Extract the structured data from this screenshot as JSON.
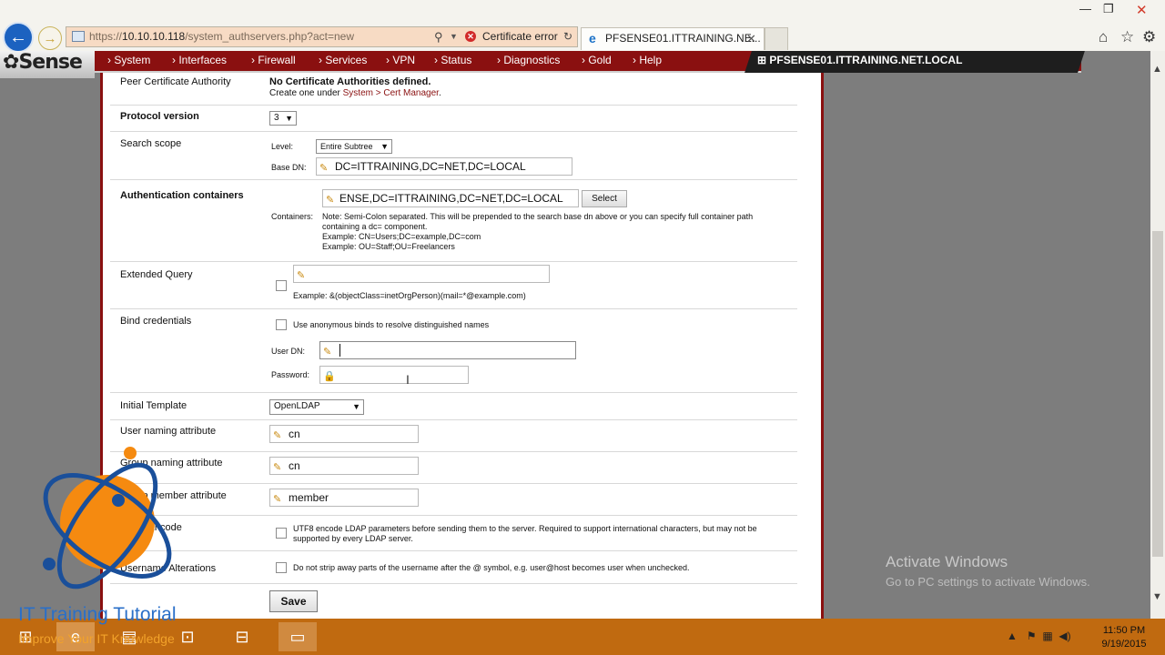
{
  "browser": {
    "url_prefix": "https://",
    "url_host": "10.10.10.118",
    "url_path": "/system_authservers.php?act=new",
    "cert_error": "Certificate error",
    "tab_title": "PFSENSE01.ITTRAINING.NE..."
  },
  "nav": {
    "logo": "Sense",
    "menu": [
      "System",
      "Interfaces",
      "Firewall",
      "Services",
      "VPN",
      "Status",
      "Diagnostics",
      "Gold",
      "Help"
    ],
    "hostname": "PFSENSE01.ITTRAINING.NET.LOCAL"
  },
  "form": {
    "peer_ca": {
      "label": "Peer Certificate Authority",
      "value": "No Certificate Authorities defined.",
      "hint_prefix": "Create one under ",
      "hint_link": "System > Cert Manager",
      "hint_suffix": "."
    },
    "protocol": {
      "label": "Protocol version",
      "value": "3"
    },
    "scope": {
      "label": "Search scope",
      "level_label": "Level:",
      "level_value": "Entire Subtree",
      "base_label": "Base DN:",
      "base_value": "DC=ITTRAINING,DC=NET,DC=LOCAL"
    },
    "containers": {
      "label": "Authentication containers",
      "sub_label": "Containers:",
      "value": "ENSE,DC=ITTRAINING,DC=NET,DC=LOCAL",
      "select_btn": "Select",
      "note1": "Note: Semi-Colon separated. This will be prepended to the search base dn above or you can specify full container path",
      "note2": "containing a dc= component.",
      "note3": "Example: CN=Users;DC=example,DC=com",
      "note4": "Example: OU=Staff;OU=Freelancers"
    },
    "ext_query": {
      "label": "Extended Query",
      "value": "",
      "example": "Example: &(objectClass=inetOrgPerson)(mail=*@example.com)"
    },
    "bind": {
      "label": "Bind credentials",
      "anon_label": "Use anonymous binds to resolve distinguished names",
      "user_label": "User DN:",
      "user_value": "",
      "pass_label": "Password:"
    },
    "template": {
      "label": "Initial Template",
      "value": "OpenLDAP"
    },
    "user_attr": {
      "label": "User naming attribute",
      "value": "cn"
    },
    "group_attr": {
      "label": "Group naming attribute",
      "value": "cn"
    },
    "member_attr": {
      "label": "Group member attribute",
      "value": "member"
    },
    "utf8": {
      "label": "UTF8 Encode",
      "text1": "UTF8 encode LDAP parameters before sending them to the server. Required to support international characters, but may not be",
      "text2": "supported by every LDAP server."
    },
    "alter": {
      "label": "Username Alterations",
      "text": "Do not strip away parts of the username after the @ symbol, e.g. user@host becomes user when unchecked."
    },
    "save": "Save"
  },
  "overlay": {
    "activate_title": "Activate Windows",
    "activate_sub": "Go to PC settings to activate Windows.",
    "brand": "IT Training Tutorial",
    "tagline": "Improve Your IT Knowledge"
  },
  "taskbar": {
    "time": "11:50 PM",
    "date": "9/19/2015"
  }
}
